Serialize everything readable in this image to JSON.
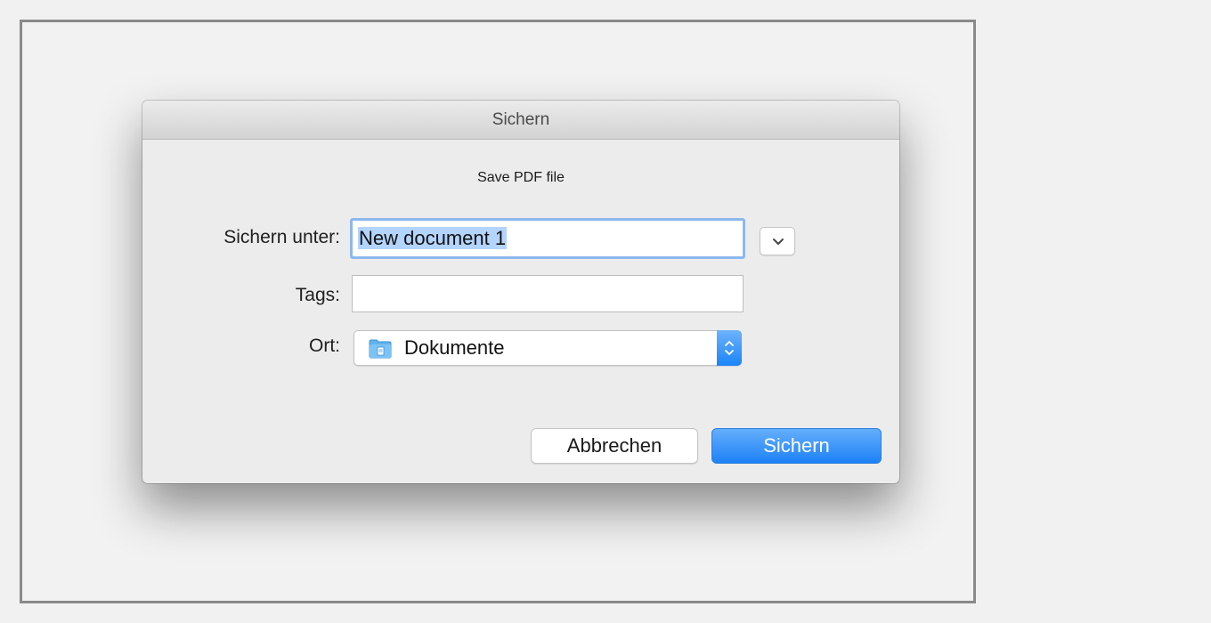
{
  "dialog": {
    "title": "Sichern",
    "subtitle": "Save PDF file"
  },
  "form": {
    "save_as_label": "Sichern unter:",
    "save_as_value": "New document 1",
    "tags_label": "Tags:",
    "tags_value": "",
    "location_label": "Ort:",
    "location_value": "Dokumente"
  },
  "buttons": {
    "cancel_label": "Abbrechen",
    "save_label": "Sichern"
  },
  "icons": {
    "expand": "chevron-down-icon",
    "folder": "folder-icon",
    "stepper": "up-down-arrows-icon"
  },
  "colors": {
    "accent": "#1d82f6",
    "focus_ring": "#8cb8ee",
    "selection": "#b3d4fd"
  }
}
